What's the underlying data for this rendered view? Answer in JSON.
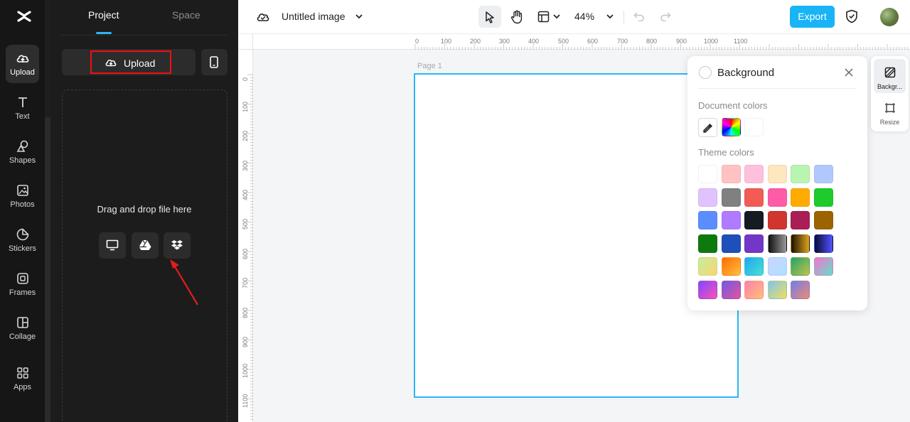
{
  "rail": {
    "items": [
      {
        "label": "Upload",
        "icon": "cloud-upload-icon"
      },
      {
        "label": "Text",
        "icon": "text-icon"
      },
      {
        "label": "Shapes",
        "icon": "shapes-icon"
      },
      {
        "label": "Photos",
        "icon": "photo-icon"
      },
      {
        "label": "Stickers",
        "icon": "sticker-icon"
      },
      {
        "label": "Frames",
        "icon": "frame-icon"
      },
      {
        "label": "Collage",
        "icon": "collage-icon"
      },
      {
        "label": "Apps",
        "icon": "apps-icon"
      }
    ]
  },
  "panel": {
    "tabs": [
      "Project",
      "Space"
    ],
    "upload_label": "Upload",
    "drop_text": "Drag and drop file here"
  },
  "topbar": {
    "title": "Untitled image",
    "zoom": "44%",
    "export_label": "Export"
  },
  "rulers": {
    "horizontal": [
      "0",
      "100",
      "200",
      "300",
      "400",
      "500",
      "600",
      "700",
      "800",
      "900",
      "1000",
      "1100"
    ],
    "vertical": [
      "0",
      "100",
      "200",
      "300",
      "400",
      "500",
      "600",
      "700",
      "800",
      "900",
      "1000",
      "1100"
    ]
  },
  "canvas": {
    "page_label": "Page 1"
  },
  "background_panel": {
    "title": "Background",
    "document_colors_label": "Document colors",
    "theme_colors_label": "Theme colors",
    "document_swatches": [
      "conic-gradient(from 0deg, #ff0000, #ffff00, #00ff00, #00ffff, #0000ff, #ff00ff, #ff0000)",
      "#ffffff"
    ],
    "theme_swatches": [
      "#ffffff",
      "#ffc2c2",
      "#ffc0dd",
      "#fde7bf",
      "#b8f5b0",
      "#b1c8ff",
      "#e0c2ff",
      "#808080",
      "#f25c54",
      "#ff5ca8",
      "#ffab00",
      "#1ecb2c",
      "#5b8dff",
      "#b07bff",
      "#161a22",
      "#d0352e",
      "#a81e55",
      "#9b6400",
      "#0e7a0d",
      "#1f4fb8",
      "#7337c8",
      "linear-gradient(90deg, #111 0%, #999 100%)",
      "linear-gradient(90deg, #1a1200 0%, #e0a31e 100%)",
      "linear-gradient(90deg, #0a0a3a 0%, #5252ff 100%)",
      "linear-gradient(135deg, #c1f0a0 0%, #fcd46f 100%)",
      "linear-gradient(135deg, #ff6a00 0%, #ffc040 100%)",
      "linear-gradient(135deg, #1ea7f3 0%, #46e0d2 100%)",
      "linear-gradient(135deg, #cfd4ff 0%, #a9e2ff 100%)",
      "linear-gradient(135deg, #1fa56a 0%, #c5c04a 100%)",
      "linear-gradient(135deg, #ff6fd0 0%, #5ce1c6 100%)",
      "linear-gradient(135deg, #7a4bff 0%, #ff4fb7 100%)",
      "linear-gradient(135deg, #6c5be8 0%, #e5539b 100%)",
      "linear-gradient(135deg, #ff7eb3 0%, #ffc170 100%)",
      "linear-gradient(135deg, #7bc6f2 0%, #f5dc5b 100%)",
      "linear-gradient(135deg, #6d7df5 0%, #f08a6c 100%)"
    ]
  },
  "right_tools": [
    {
      "label": "Backgr...",
      "icon": "background-icon"
    },
    {
      "label": "Resize",
      "icon": "resize-icon"
    }
  ],
  "colors": {
    "accent": "#18b4f5",
    "highlight_box": "#ee1111",
    "annotation_arrow": "#e11d1d"
  }
}
